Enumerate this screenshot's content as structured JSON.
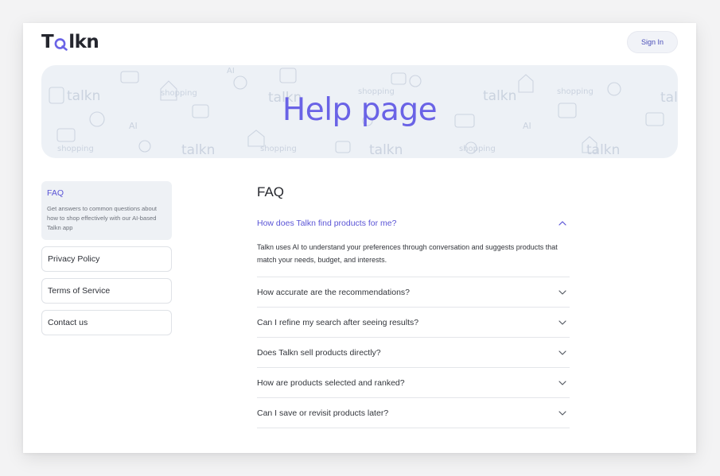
{
  "header": {
    "logo_before": "T",
    "logo_after": "lkn",
    "signin_label": "Sign In"
  },
  "banner": {
    "title": "Help page",
    "pattern_words": [
      "talkn",
      "shopping",
      "AI"
    ]
  },
  "sidebar": {
    "active": {
      "label": "FAQ",
      "description": "Get answers to common questions about how to shop effectively with our AI-based Talkn app"
    },
    "items": [
      {
        "label": "Privacy Policy"
      },
      {
        "label": "Terms of Service"
      },
      {
        "label": "Contact us"
      }
    ]
  },
  "faq": {
    "title": "FAQ",
    "open": {
      "question": "How does Talkn find products for me?",
      "answer": "Talkn uses AI to understand your preferences through conversation and suggests products that match your needs, budget, and interests."
    },
    "items": [
      {
        "question": "How accurate are the recommendations?"
      },
      {
        "question": "Can I refine my search after seeing results?"
      },
      {
        "question": "Does Talkn sell products directly?"
      },
      {
        "question": "How are products selected and ranked?"
      },
      {
        "question": "Can I save or revisit products later?"
      }
    ]
  },
  "colors": {
    "accent": "#6a63e6",
    "link": "#5a54d6",
    "banner_bg": "#edf1f6"
  }
}
